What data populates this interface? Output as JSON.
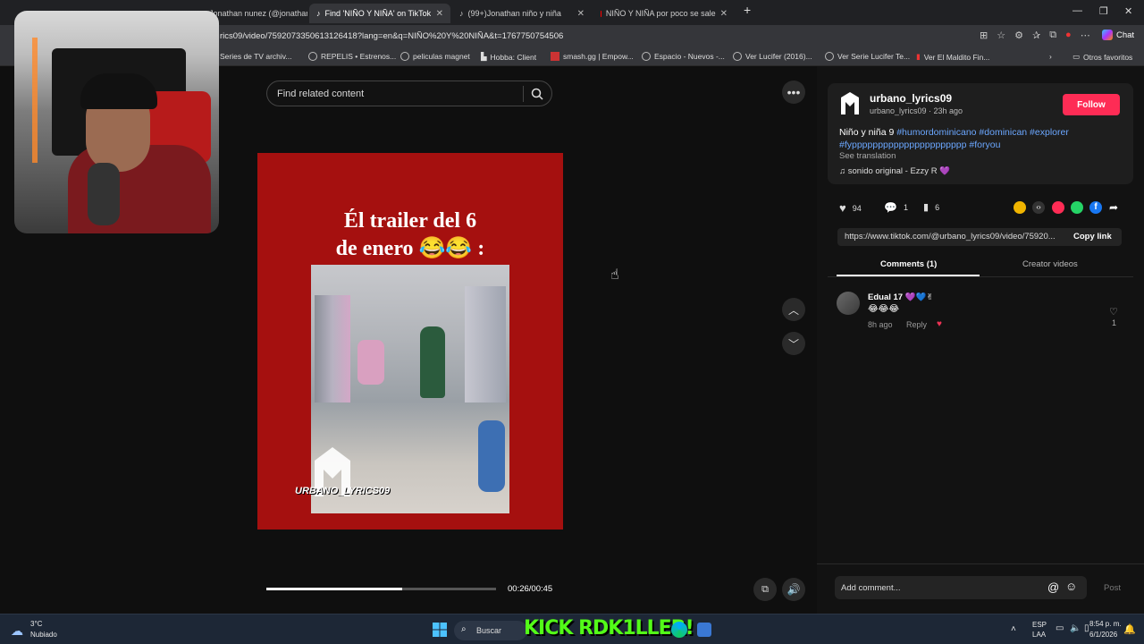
{
  "browser": {
    "tabs": [
      {
        "label": "Jonathan nunez (@jonathan"
      },
      {
        "label": "Find 'NIÑO Y NIÑA' on TikTok"
      },
      {
        "label": "(99+)Jonathan niño y niña"
      },
      {
        "label": "NIÑO Y NIÑA por poco se sale"
      }
    ],
    "new_tab": "+",
    "url": "rics09/video/7592073350613126418?lang=en&q=NIÑO%20Y%20NIÑA&t=1767750754506",
    "chat_label": "Chat",
    "bookmarks": [
      "Series de TV archiv...",
      "REPELIS • Estrenos...",
      "peliculas magnet",
      "Hobba: Client",
      "smash.gg | Empow...",
      "Espacio - Nuevos -...",
      "Ver Lucifer (2016)...",
      "Ver Serie Lucifer Te...",
      "Ver El Maldito Fin..."
    ],
    "other_bookmarks": "Otros favoritos"
  },
  "search": {
    "placeholder": "Find related content"
  },
  "video": {
    "title_line1": "Él trailer del 6",
    "title_line2": "de enero 😂😂 :",
    "watermark": "URBANO_LYRICS09",
    "progress": 0.59,
    "time": "00:26/00:45"
  },
  "post": {
    "username": "urbano_lyrics09",
    "subline": "urbano_lyrics09 · 23h ago",
    "follow_label": "Follow",
    "desc_text": "Niño y niña 9 ",
    "hashtags1": "#humordominicano #dominican #explorer",
    "hashtags2": "#fypppppppppppppppppppppp #foryou",
    "see_translation": "See translation",
    "music": "sonido original - Ezzy R 💜",
    "likes": "94",
    "comments": "1",
    "saves": "6",
    "link": "https://www.tiktok.com/@urbano_lyrics09/video/75920...",
    "copy_label": "Copy link",
    "tab_comments": "Comments (1)",
    "tab_creator": "Creator videos"
  },
  "comment": {
    "author": "Edual 17 💜💙✌",
    "text": "😂😂😂",
    "time": "8h ago",
    "reply": "Reply",
    "like_count": "1"
  },
  "comment_input": {
    "placeholder": "Add comment...",
    "post_label": "Post"
  },
  "taskbar": {
    "temp": "3°C",
    "weather": "Nubiado",
    "search": "Buscar",
    "lang1": "ESP",
    "lang2": "LAA",
    "clock": "8:54 p. m.",
    "date": "6/1/2026",
    "overlay": "KICK RDK1LLER!"
  },
  "colors": {
    "follow": "#fe2c55",
    "hashtag": "#6ba7ff",
    "video_bg": "#a5100f"
  }
}
